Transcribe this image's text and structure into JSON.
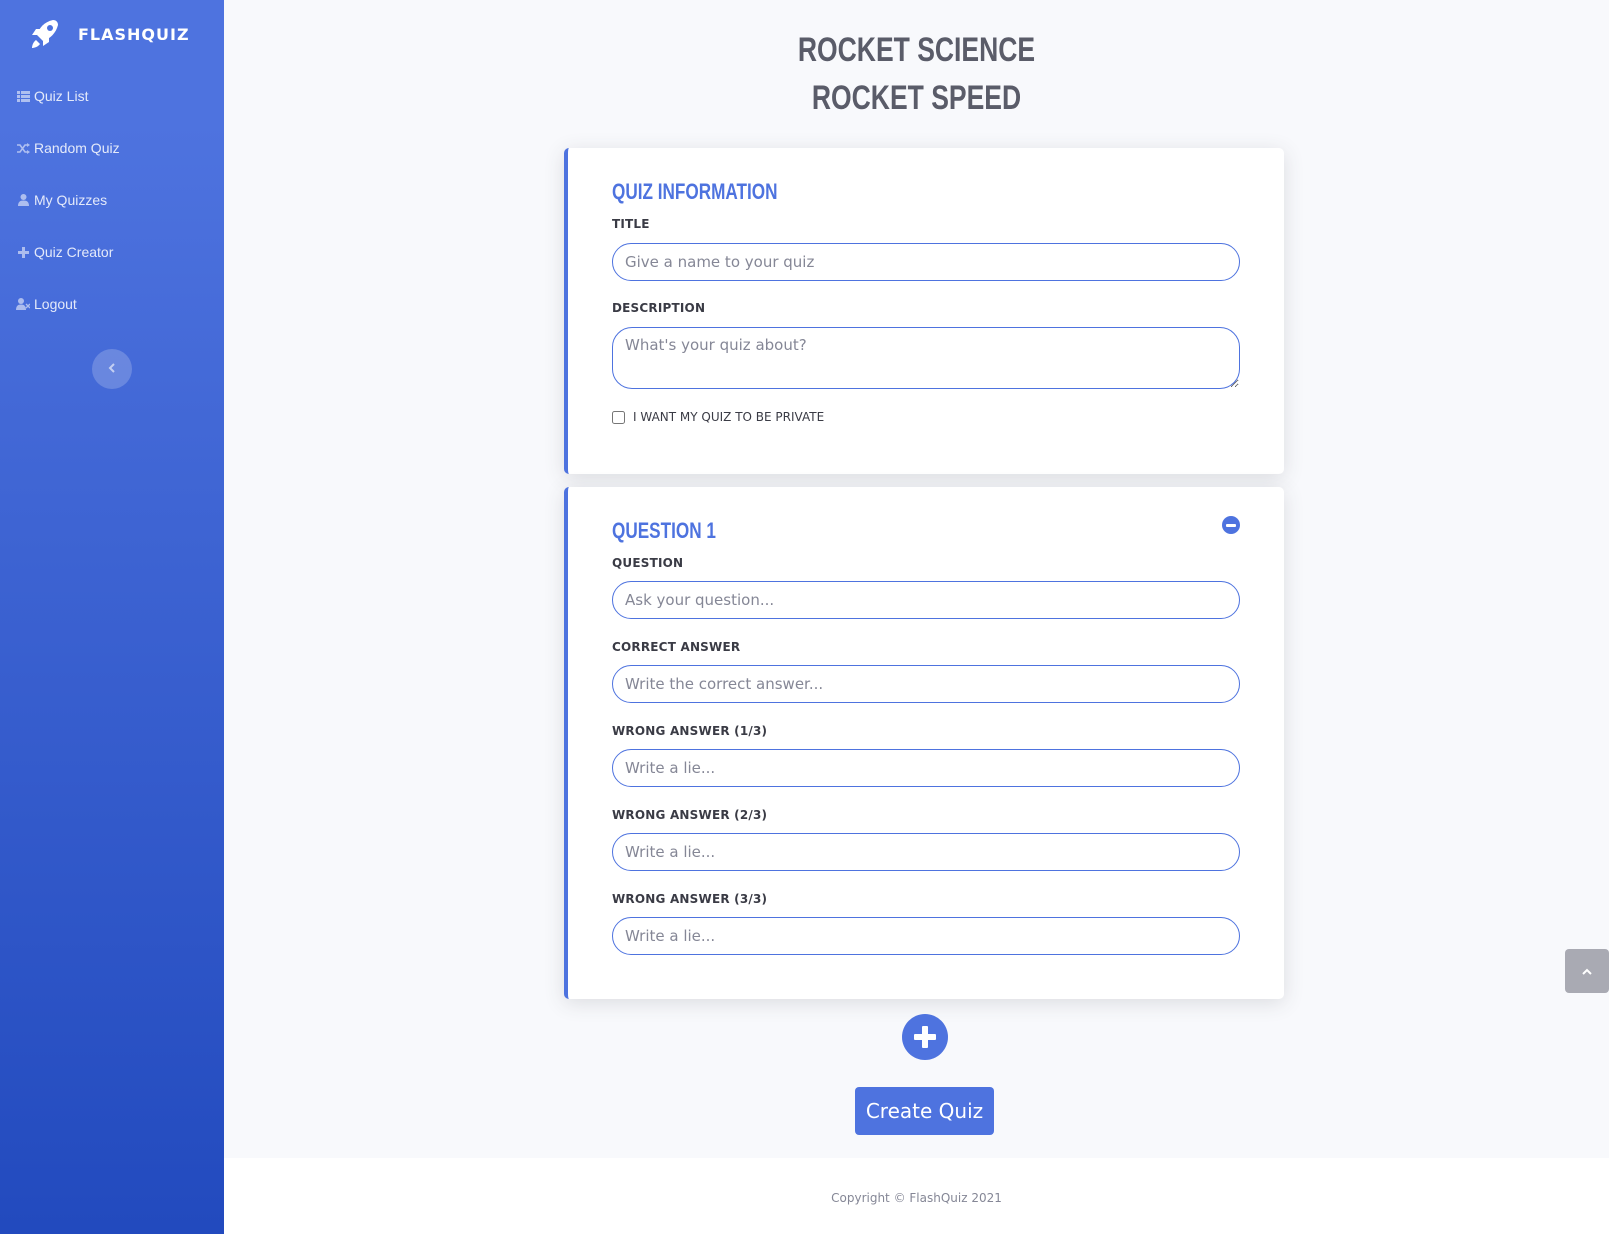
{
  "sidebar": {
    "brand": "FLASHQUIZ",
    "brand_icon": "rocket-icon",
    "items": [
      {
        "label": "Quiz List",
        "icon": "list-icon"
      },
      {
        "label": "Random Quiz",
        "icon": "random-icon"
      },
      {
        "label": "My Quizzes",
        "icon": "user-icon"
      },
      {
        "label": "Quiz Creator",
        "icon": "plus-icon"
      },
      {
        "label": "Logout",
        "icon": "user-times-icon"
      }
    ],
    "toggle_icon": "chevron-left-icon"
  },
  "header": {
    "line1": "ROCKET SCIENCE",
    "line2": "ROCKET SPEED"
  },
  "quiz_info": {
    "title": "QUIZ INFORMATION",
    "title_label": "TITLE",
    "title_placeholder": "Give a name to your quiz",
    "description_label": "DESCRIPTION",
    "description_placeholder": "What's your quiz about?",
    "private_label": "I WANT MY QUIZ TO BE PRIVATE"
  },
  "question": {
    "title": "QUESTION 1",
    "question_label": "QUESTION",
    "question_placeholder": "Ask your question...",
    "correct_label": "CORRECT ANSWER",
    "correct_placeholder": "Write the correct answer...",
    "wrong": [
      {
        "label": "WRONG ANSWER (1/3)",
        "placeholder": "Write a lie..."
      },
      {
        "label": "WRONG ANSWER (2/3)",
        "placeholder": "Write a lie..."
      },
      {
        "label": "WRONG ANSWER (3/3)",
        "placeholder": "Write a lie..."
      }
    ]
  },
  "actions": {
    "create_label": "Create Quiz"
  },
  "footer": {
    "copyright": "Copyright © FlashQuiz 2021"
  },
  "colors": {
    "primary": "#4e73df",
    "sidebar_bottom": "#224abe",
    "background": "#f8f9fc"
  }
}
